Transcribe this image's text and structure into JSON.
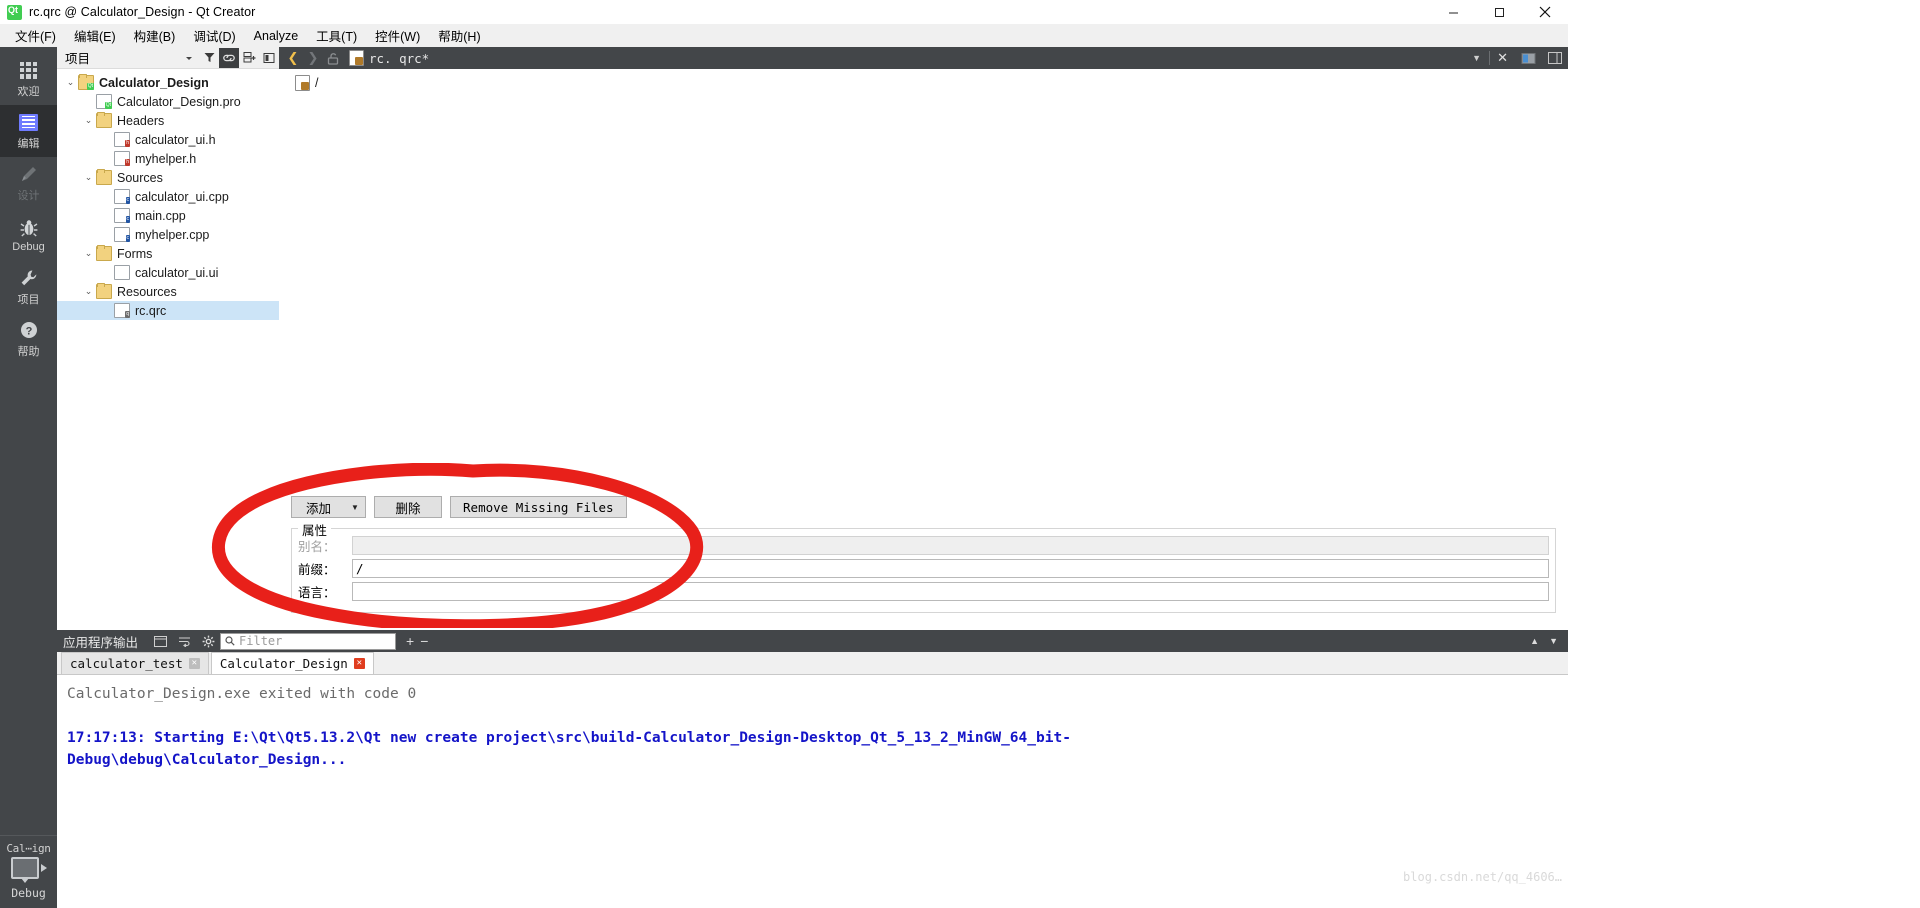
{
  "window": {
    "title": "rc.qrc @ Calculator_Design - Qt Creator",
    "logo_icon": "qt-logo-icon",
    "minimize_label": "─",
    "maximize_label": "❐",
    "close_label": "✕"
  },
  "menubar": {
    "items": [
      {
        "label": "文件(F)",
        "name": "menu-file"
      },
      {
        "label": "编辑(E)",
        "name": "menu-edit"
      },
      {
        "label": "构建(B)",
        "name": "menu-build"
      },
      {
        "label": "调试(D)",
        "name": "menu-debug"
      },
      {
        "label": "Analyze",
        "name": "menu-analyze"
      },
      {
        "label": "工具(T)",
        "name": "menu-tools"
      },
      {
        "label": "控件(W)",
        "name": "menu-widgets"
      },
      {
        "label": "帮助(H)",
        "name": "menu-help"
      }
    ]
  },
  "modebar": {
    "modes": [
      {
        "label": "欢迎",
        "icon": "grid-icon",
        "active": false,
        "dim": false
      },
      {
        "label": "编辑",
        "icon": "document-icon",
        "active": true,
        "dim": false
      },
      {
        "label": "设计",
        "icon": "pencil-icon",
        "active": false,
        "dim": true
      },
      {
        "label": "Debug",
        "icon": "bug-icon",
        "active": false,
        "dim": false
      },
      {
        "label": "项目",
        "icon": "wrench-icon",
        "active": false,
        "dim": false
      },
      {
        "label": "帮助",
        "icon": "question-icon",
        "active": false,
        "dim": false
      }
    ],
    "kit_label": "Cal⋯ign",
    "run_label": "Debug",
    "run_icon": "monitor-icon",
    "run_arrow_icon": "play-arrow-icon"
  },
  "project_pane": {
    "title": "项目",
    "tools": [
      "filter-icon",
      "link-icon",
      "expand-icon",
      "sidebar-icon"
    ],
    "tree": [
      {
        "label": "Calculator_Design",
        "indent": 0,
        "chevron": "⌄",
        "icon": "qt-project-icon",
        "bold": true,
        "selected": false
      },
      {
        "label": "Calculator_Design.pro",
        "indent": 1,
        "chevron": "",
        "icon": "qt-pro-file-icon",
        "bold": false,
        "selected": false
      },
      {
        "label": "Headers",
        "indent": 1,
        "chevron": "⌄",
        "icon": "folder-headers-icon",
        "bold": false,
        "selected": false
      },
      {
        "label": "calculator_ui.h",
        "indent": 2,
        "chevron": "",
        "icon": "header-file-icon",
        "bold": false,
        "selected": false
      },
      {
        "label": "myhelper.h",
        "indent": 2,
        "chevron": "",
        "icon": "header-file-icon",
        "bold": false,
        "selected": false
      },
      {
        "label": "Sources",
        "indent": 1,
        "chevron": "⌄",
        "icon": "folder-sources-icon",
        "bold": false,
        "selected": false
      },
      {
        "label": "calculator_ui.cpp",
        "indent": 2,
        "chevron": "",
        "icon": "cpp-file-icon",
        "bold": false,
        "selected": false
      },
      {
        "label": "main.cpp",
        "indent": 2,
        "chevron": "",
        "icon": "cpp-file-icon",
        "bold": false,
        "selected": false
      },
      {
        "label": "myhelper.cpp",
        "indent": 2,
        "chevron": "",
        "icon": "cpp-file-icon",
        "bold": false,
        "selected": false
      },
      {
        "label": "Forms",
        "indent": 1,
        "chevron": "⌄",
        "icon": "folder-forms-icon",
        "bold": false,
        "selected": false
      },
      {
        "label": "calculator_ui.ui",
        "indent": 2,
        "chevron": "",
        "icon": "ui-file-icon",
        "bold": false,
        "selected": false
      },
      {
        "label": "Resources",
        "indent": 1,
        "chevron": "⌄",
        "icon": "folder-resources-icon",
        "bold": false,
        "selected": false
      },
      {
        "label": "rc.qrc",
        "indent": 2,
        "chevron": "",
        "icon": "qrc-file-icon",
        "bold": false,
        "selected": true
      }
    ]
  },
  "editor": {
    "back_icon": "back-arrow-icon",
    "forward_icon": "forward-arrow-icon",
    "lock_icon": "unlocked-icon",
    "tab_label": "rc. qrc*",
    "tab_icon": "qrc-file-icon",
    "dropdown_icon": "chevron-down-icon",
    "close_icon": "close-icon",
    "split_icon": "split-editor-icon",
    "resource_root": "/",
    "resource_root_icon": "qrc-prefix-icon"
  },
  "resource_panel": {
    "add_label": "添加",
    "add_arrow": "▼",
    "remove_label": "删除",
    "remove_missing_label": "Remove Missing Files",
    "properties_title": "属性",
    "fields": [
      {
        "label": "别名：",
        "value": "",
        "disabled": true,
        "name": "alias-field"
      },
      {
        "label": "前缀：",
        "value": "/",
        "disabled": false,
        "name": "prefix-field"
      },
      {
        "label": "语言：",
        "value": "",
        "disabled": false,
        "name": "language-field"
      }
    ]
  },
  "output_pane": {
    "title": "应用程序输出",
    "icons": [
      "window-icon",
      "wrap-icon",
      "gear-icon"
    ],
    "filter_placeholder": "Filter",
    "search_icon": "search-icon",
    "zoom_in_label": "+",
    "zoom_out_label": "−",
    "minimize_icon": "chevron-up-icon",
    "maximize_icon": "chevron-down-icon",
    "tabs": [
      {
        "label": "calculator_test",
        "active": false,
        "close_icon": "close-icon",
        "close_red": false
      },
      {
        "label": "Calculator_Design",
        "active": true,
        "close_icon": "close-icon",
        "close_red": true
      }
    ],
    "lines": [
      {
        "text": "Calculator_Design.exe exited with code 0",
        "style": "grey"
      },
      {
        "text": "",
        "style": "grey"
      },
      {
        "text": "17:17:13: Starting E:\\Qt\\Qt5.13.2\\Qt new create project\\src\\build-Calculator_Design-Desktop_Qt_5_13_2_MinGW_64_bit-",
        "style": "blue"
      },
      {
        "text": "Debug\\debug\\Calculator_Design...",
        "style": "blue"
      }
    ]
  },
  "annotation": {
    "shape": "red-ellipse-highlight",
    "color": "#e8201a"
  },
  "watermark": {
    "text": "blog.csdn.net/qq_4606…"
  }
}
